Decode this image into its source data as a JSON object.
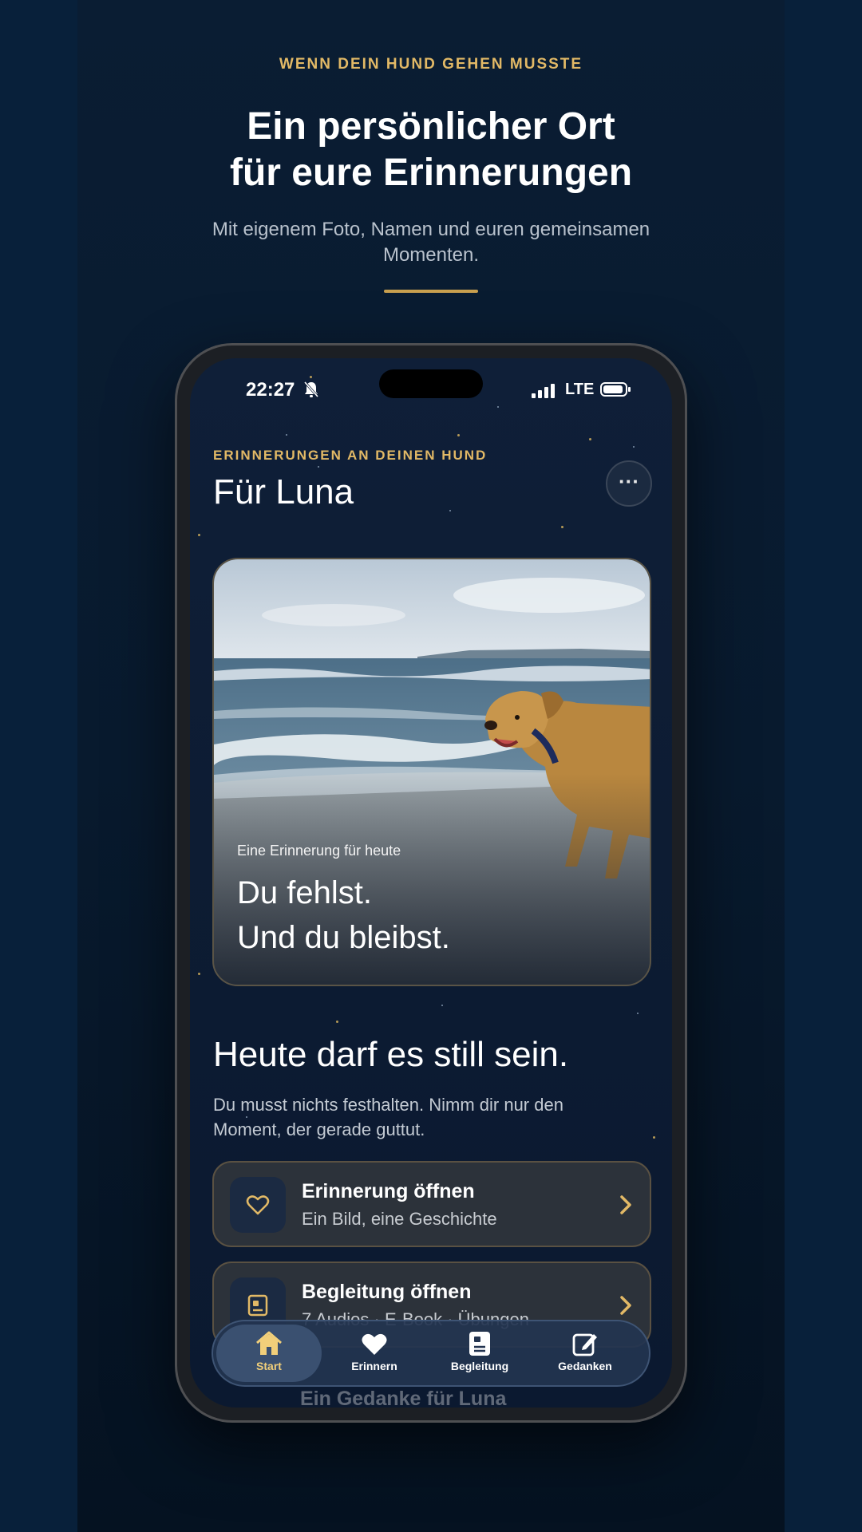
{
  "header": {
    "eyebrow": "WENN DEIN HUND GEHEN MUSSTE",
    "headline_line1": "Ein persönlicher Ort",
    "headline_line2": "für eure Erinnerungen",
    "subline": "Mit eigenem Foto, Namen und euren gemeinsamen Momenten."
  },
  "status_bar": {
    "time": "22:27",
    "network": "LTE",
    "icons": [
      "bell-muted-icon",
      "signal-icon",
      "battery-icon"
    ]
  },
  "app": {
    "eyebrow": "ERINNERUNGEN AN DEINEN HUND",
    "title": "Für Luna",
    "more_button": "···",
    "hero": {
      "caption": "Eine Erinnerung für heute",
      "quote_line1": "Du fehlst.",
      "quote_line2": "Und du bleibst."
    },
    "section_title": "Heute darf es still sein.",
    "section_text": "Du musst nichts festhalten. Nimm dir nur den Moment, der gerade guttut.",
    "actions": [
      {
        "title": "Erinnerung öffnen",
        "subtitle": "Ein Bild, eine Geschichte",
        "icon": "heart-icon"
      },
      {
        "title": "Begleitung öffnen",
        "subtitle": "7 Audios · E-Book · Übungen",
        "icon": "book-icon"
      }
    ],
    "partial_card": {
      "title": "Ein Gedanke für Luna"
    },
    "tabs": [
      {
        "label": "Start",
        "icon": "home-icon",
        "active": true
      },
      {
        "label": "Erinnern",
        "icon": "heart-icon",
        "active": false
      },
      {
        "label": "Begleitung",
        "icon": "book-icon",
        "active": false
      },
      {
        "label": "Gedanken",
        "icon": "edit-icon",
        "active": false
      }
    ]
  },
  "colors": {
    "accent_gold": "#e2b966",
    "background": "#0a1d33",
    "card": "#2c323a"
  }
}
